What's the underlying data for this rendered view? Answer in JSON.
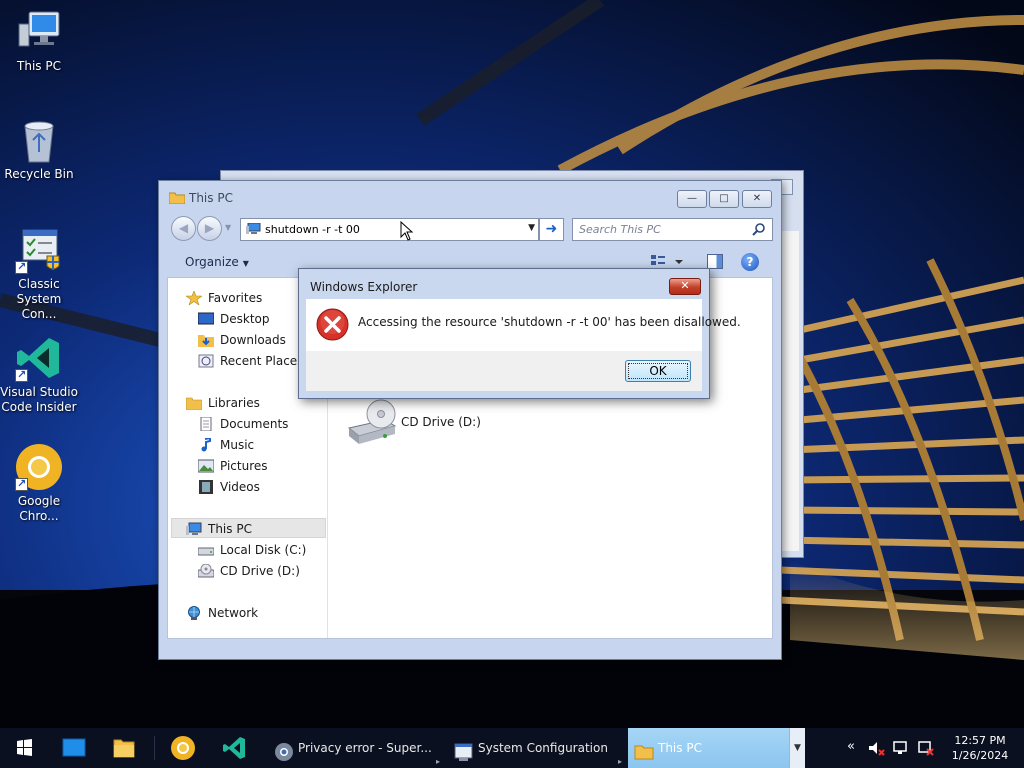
{
  "desktop": {
    "icons": [
      {
        "label": "This PC",
        "icon": "this-pc-icon"
      },
      {
        "label": "Recycle Bin",
        "icon": "recycle-bin-icon"
      },
      {
        "label": "Classic\nSystem Con...",
        "icon": "system-config-icon"
      },
      {
        "label": "Visual Studio\nCode Insider",
        "icon": "vscode-insiders-icon"
      },
      {
        "label": "Google\nChro...",
        "icon": "chrome-icon"
      }
    ]
  },
  "explorer": {
    "title": "This PC",
    "address": "shutdown -r -t 00",
    "search_placeholder": "Search This PC",
    "organize_label": "Organize",
    "nav": {
      "favorites": "Favorites",
      "desktop": "Desktop",
      "downloads": "Downloads",
      "recent_places": "Recent Places",
      "libraries": "Libraries",
      "documents": "Documents",
      "music": "Music",
      "pictures": "Pictures",
      "videos": "Videos",
      "this_pc": "This PC",
      "local_disk": "Local Disk (C:)",
      "cd_drive": "CD Drive (D:)",
      "network": "Network"
    },
    "main_items": [
      {
        "label": "CD Drive (D:)",
        "icon": "cd-drive-icon"
      }
    ]
  },
  "dialog": {
    "title": "Windows Explorer",
    "message": "Accessing the resource 'shutdown -r -t 00' has been disallowed.",
    "ok_label": "OK",
    "icon": "error-icon"
  },
  "taskbar": {
    "pinned": [
      "start-icon",
      "desktop-icon",
      "file-explorer-icon",
      "chrome-icon",
      "vscode-insiders-icon"
    ],
    "tasks": [
      {
        "label": "Privacy error - Super...",
        "icon": "chrome-icon"
      },
      {
        "label": "System Configuration",
        "icon": "system-config-icon"
      },
      {
        "label": "This PC",
        "icon": "folder-icon"
      }
    ],
    "tray": [
      "chevron-left-icon",
      "speaker-muted-icon",
      "network-icon",
      "action-center-icon"
    ],
    "time": "12:57 PM",
    "date": "1/26/2024"
  },
  "colors": {
    "accent": "#1d60c8",
    "error": "#c42b1c",
    "active_task": "#9fd0f3"
  }
}
